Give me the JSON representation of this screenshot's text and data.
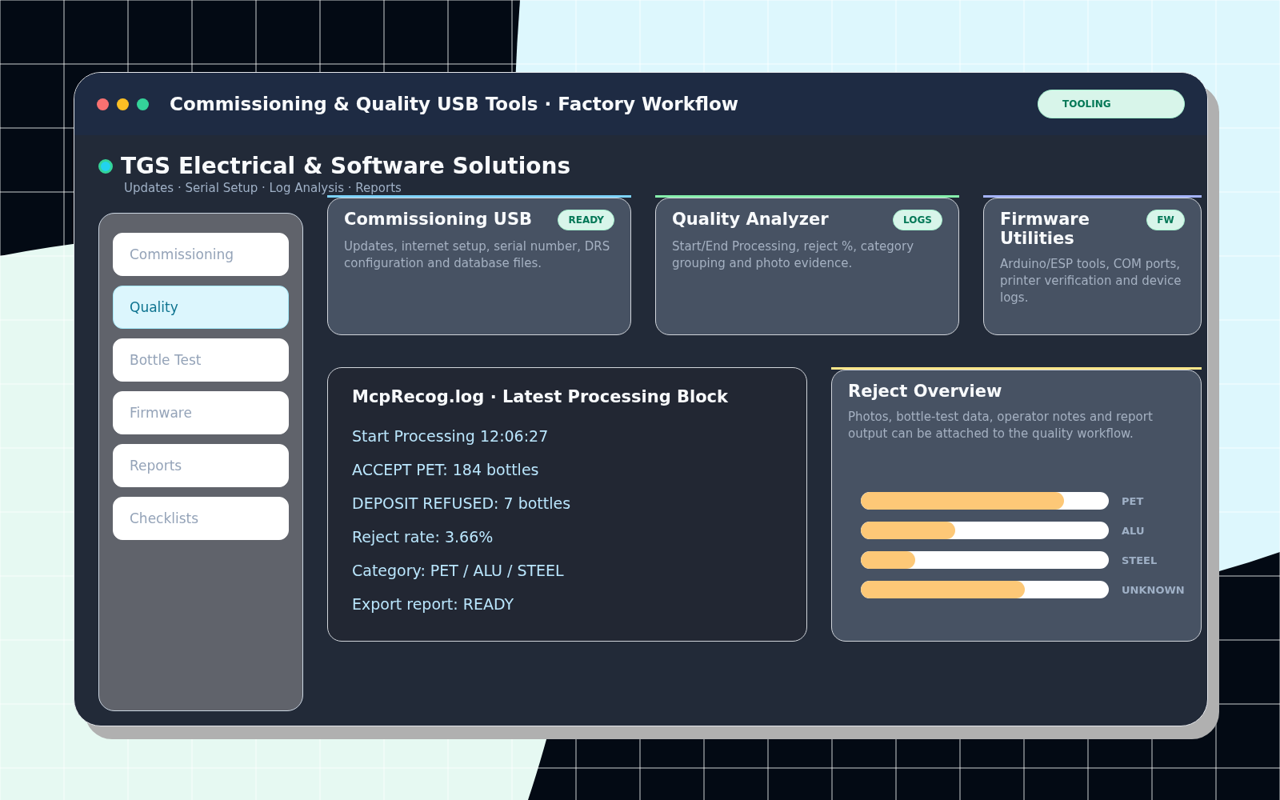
{
  "window": {
    "title": "Commissioning & Quality USB Tools · Factory Workflow",
    "badge": "TOOLING"
  },
  "header": {
    "title": "TGS Electrical & Software Solutions",
    "subtitle": "Updates · Serial Setup · Log Analysis · Reports"
  },
  "sidebar": {
    "items": [
      {
        "label": "Commissioning",
        "selected": false
      },
      {
        "label": "Quality",
        "selected": true
      },
      {
        "label": "Bottle Test",
        "selected": false
      },
      {
        "label": "Firmware",
        "selected": false
      },
      {
        "label": "Reports",
        "selected": false
      },
      {
        "label": "Checklists",
        "selected": false
      }
    ]
  },
  "cards": [
    {
      "title": "Commissioning USB",
      "badge": "READY",
      "text": "Updates, internet setup, serial number, DRS configuration and database files.",
      "color": "#7dd3fc"
    },
    {
      "title": "Quality Analyzer",
      "badge": "LOGS",
      "text": "Start/End Processing, reject %, category grouping and photo evidence.",
      "color": "#86efac"
    },
    {
      "title": "Firmware Utilities",
      "badge": "FW",
      "text": "Arduino/ESP tools, COM ports, printer verification and device logs.",
      "color": "#a5b4fc"
    }
  ],
  "log": {
    "title": "McpRecog.log · Latest Processing Block",
    "lines": [
      "Start Processing 12:06:27",
      "ACCEPT PET: 184 bottles",
      "DEPOSIT REFUSED: 7 bottles",
      "Reject rate: 3.66%",
      "Category: PET / ALU / STEEL",
      "Export report: READY"
    ]
  },
  "reject": {
    "title": "Reject Overview",
    "text": "Photos, bottle-test data, operator notes and report output can be attached to the quality workflow.",
    "color": "#fde68a",
    "bars": [
      {
        "label": "PET",
        "level": 0.82
      },
      {
        "label": "ALU",
        "level": 0.38
      },
      {
        "label": "STEEL",
        "level": 0.22
      },
      {
        "label": "UNKNOWN",
        "level": 0.66
      }
    ]
  }
}
